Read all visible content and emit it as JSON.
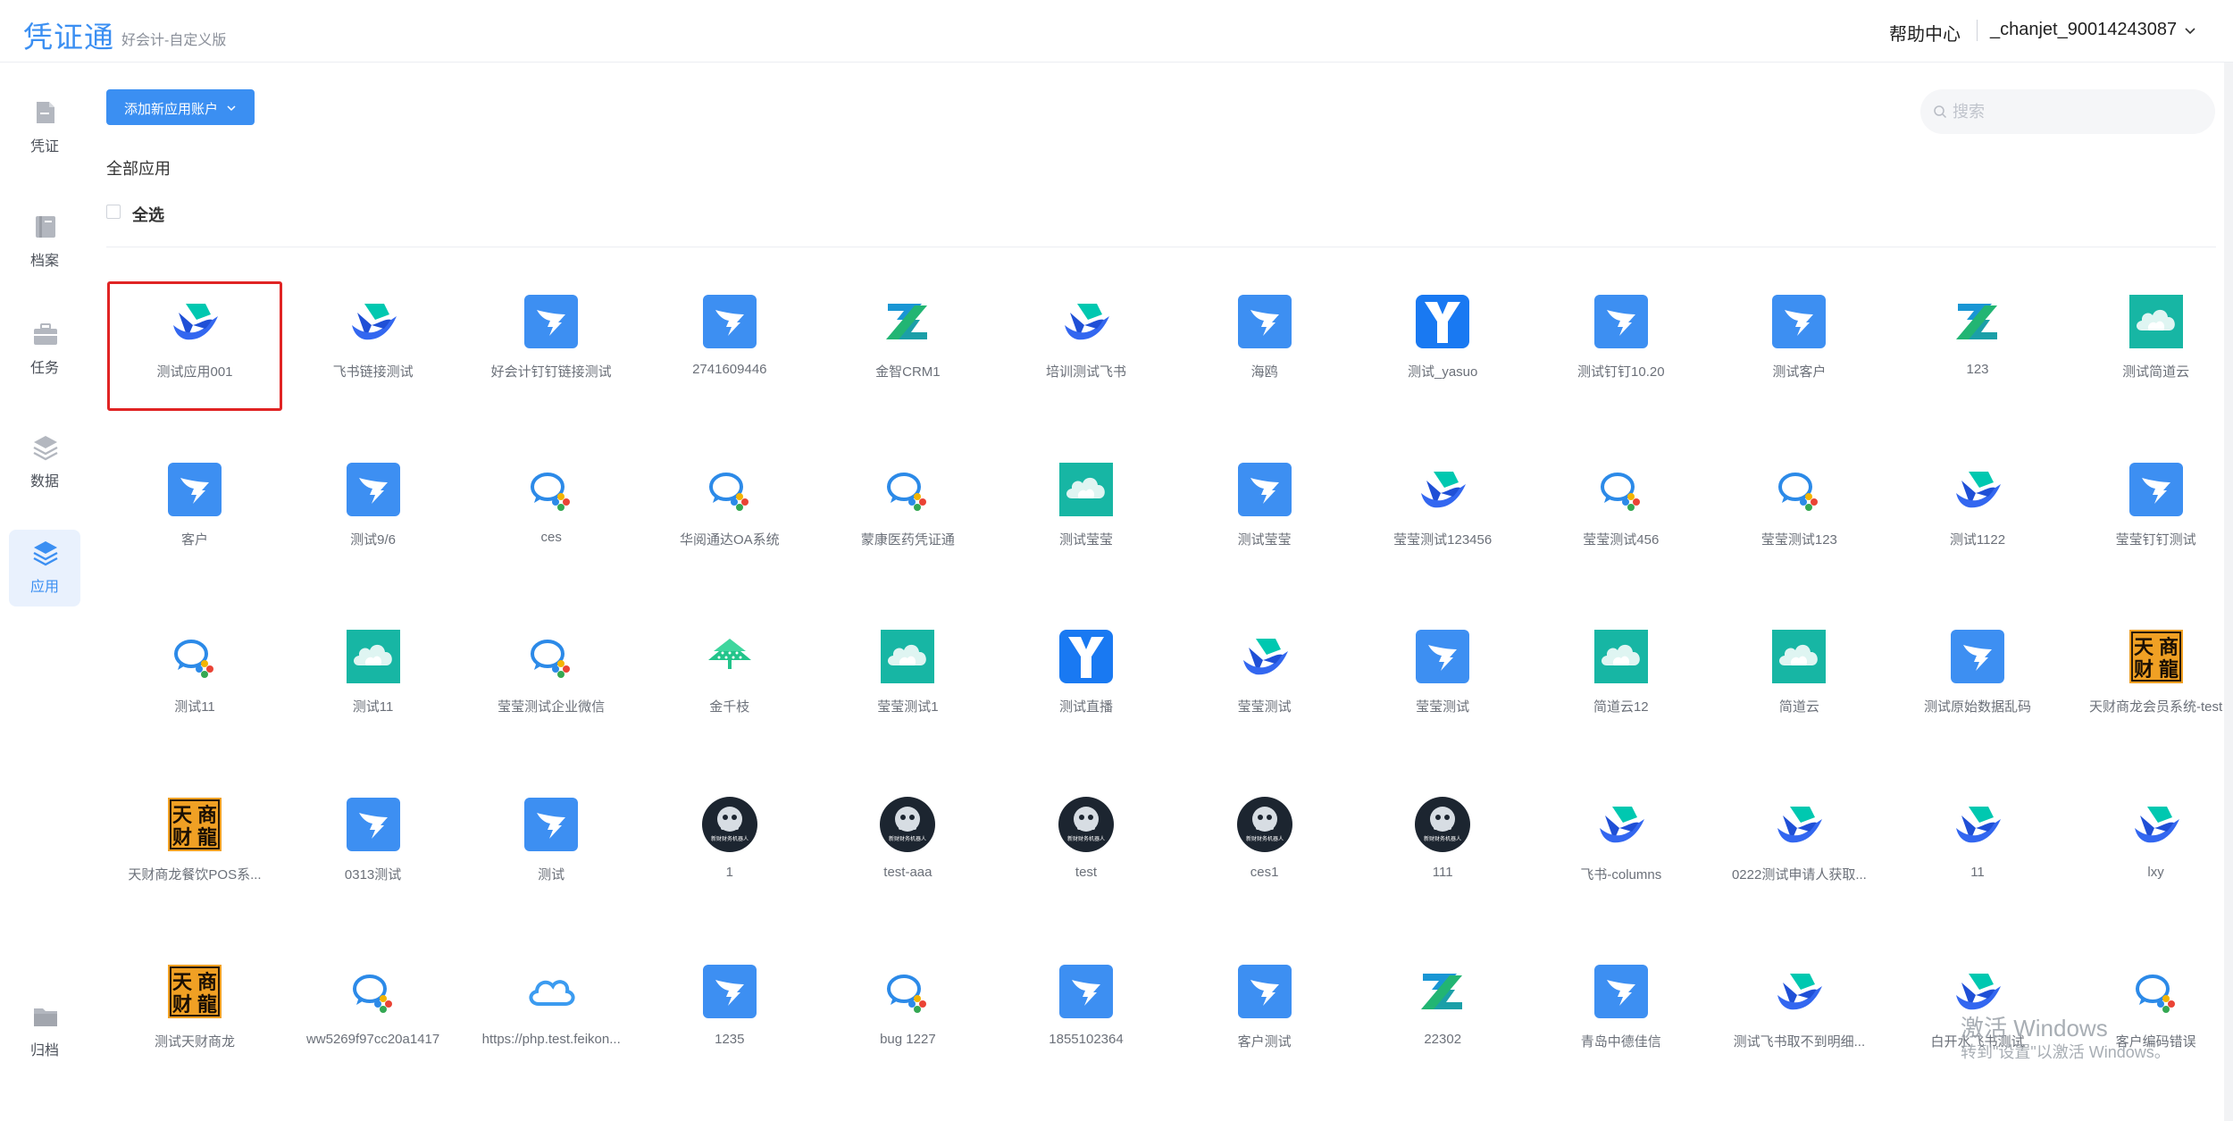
{
  "header": {
    "logo": "凭证通",
    "edition": "好会计-自定义版",
    "help": "帮助中心",
    "user": "_chanjet_90014243087"
  },
  "sidebar": {
    "items": [
      {
        "label": "凭证",
        "icon": "voucher-icon"
      },
      {
        "label": "档案",
        "icon": "book-icon"
      },
      {
        "label": "任务",
        "icon": "briefcase-icon"
      },
      {
        "label": "数据",
        "icon": "layers-icon"
      },
      {
        "label": "应用",
        "icon": "apps-stack-icon",
        "active": true
      },
      {
        "label": "归档",
        "icon": "folder-icon"
      }
    ]
  },
  "toolbar": {
    "add_label": "添加新应用账户",
    "search_placeholder": "搜索"
  },
  "section": {
    "title": "全部应用",
    "select_all": "全选"
  },
  "apps": [
    {
      "name": "测试应用001",
      "icon": "feishu",
      "selected": true
    },
    {
      "name": "飞书链接测试",
      "icon": "feishu"
    },
    {
      "name": "好会计钉钉链接测试",
      "icon": "dingtalk"
    },
    {
      "name": "2741609446",
      "icon": "dingtalk"
    },
    {
      "name": "金智CRM1",
      "icon": "zcrm"
    },
    {
      "name": "培训测试飞书",
      "icon": "feishu"
    },
    {
      "name": "海鸥",
      "icon": "dingtalk"
    },
    {
      "name": "测试_yasuo",
      "icon": "yonyou"
    },
    {
      "name": "测试钉钉10.20",
      "icon": "dingtalk"
    },
    {
      "name": "测试客户",
      "icon": "dingtalk"
    },
    {
      "name": "123",
      "icon": "zcrm"
    },
    {
      "name": "测试简道云",
      "icon": "jdy"
    },
    {
      "name": "客户",
      "icon": "dingtalk"
    },
    {
      "name": "测试9/6",
      "icon": "dingtalk"
    },
    {
      "name": "ces",
      "icon": "wecom"
    },
    {
      "name": "华阅通达OA系统",
      "icon": "wecom"
    },
    {
      "name": "蒙康医药凭证通",
      "icon": "wecom"
    },
    {
      "name": "测试莹莹",
      "icon": "jdy"
    },
    {
      "name": "测试莹莹",
      "icon": "dingtalk"
    },
    {
      "name": "莹莹测试123456",
      "icon": "feishu"
    },
    {
      "name": "莹莹测试456",
      "icon": "wecom"
    },
    {
      "name": "莹莹测试123",
      "icon": "wecom"
    },
    {
      "name": "测试1122",
      "icon": "feishu"
    },
    {
      "name": "莹莹钉钉测试",
      "icon": "dingtalk"
    },
    {
      "name": "测试11",
      "icon": "wecom"
    },
    {
      "name": "测试11",
      "icon": "jdy"
    },
    {
      "name": "莹莹测试企业微信",
      "icon": "wecom"
    },
    {
      "name": "金千枝",
      "icon": "jqz"
    },
    {
      "name": "莹莹测试1",
      "icon": "jdy"
    },
    {
      "name": "测试直播",
      "icon": "yonyou"
    },
    {
      "name": "莹莹测试",
      "icon": "feishu"
    },
    {
      "name": "莹莹测试",
      "icon": "dingtalk"
    },
    {
      "name": "简道云12",
      "icon": "jdy"
    },
    {
      "name": "简道云",
      "icon": "jdy"
    },
    {
      "name": "测试原始数据乱码",
      "icon": "dingtalk"
    },
    {
      "name": "天财商龙会员系统-test",
      "icon": "tcsl"
    },
    {
      "name": "天财商龙餐饮POS系...",
      "icon": "tcsl"
    },
    {
      "name": "0313测试",
      "icon": "dingtalk"
    },
    {
      "name": "测试",
      "icon": "dingtalk"
    },
    {
      "name": "1",
      "icon": "robot"
    },
    {
      "name": "test-aaa",
      "icon": "robot"
    },
    {
      "name": "test",
      "icon": "robot"
    },
    {
      "name": "ces1",
      "icon": "robot"
    },
    {
      "name": "111",
      "icon": "robot"
    },
    {
      "name": "飞书-columns",
      "icon": "feishu"
    },
    {
      "name": "0222测试申请人获取...",
      "icon": "feishu"
    },
    {
      "name": "11",
      "icon": "feishu"
    },
    {
      "name": "lxy",
      "icon": "feishu"
    },
    {
      "name": "测试天财商龙",
      "icon": "tcsl"
    },
    {
      "name": "ww5269f97cc20a1417",
      "icon": "wecom"
    },
    {
      "name": "https://php.test.feikon...",
      "icon": "cloud"
    },
    {
      "name": "1235",
      "icon": "dingtalk"
    },
    {
      "name": "bug 1227",
      "icon": "wecom"
    },
    {
      "name": "1855102364",
      "icon": "dingtalk"
    },
    {
      "name": "客户测试",
      "icon": "dingtalk"
    },
    {
      "name": "22302",
      "icon": "zcrm"
    },
    {
      "name": "青岛中德佳信",
      "icon": "dingtalk"
    },
    {
      "name": "测试飞书取不到明细...",
      "icon": "feishu"
    },
    {
      "name": "白开水飞书测试",
      "icon": "feishu"
    },
    {
      "name": "客户编码错误",
      "icon": "wecom"
    }
  ],
  "icon_text": {
    "robot": "新财财务机器人",
    "tcsl": [
      "天",
      "商",
      "财",
      "龍"
    ]
  },
  "watermark": {
    "line1": "激活 Windows",
    "line2": "转到\"设置\"以激活 Windows。"
  },
  "colors": {
    "primary": "#3b8ff2",
    "dingtalk": "#3d8ff2",
    "jdy": "#17b6a4",
    "robot": "#1c2530",
    "tcsl_bg": "#f0a024",
    "selection": "#e02424"
  }
}
